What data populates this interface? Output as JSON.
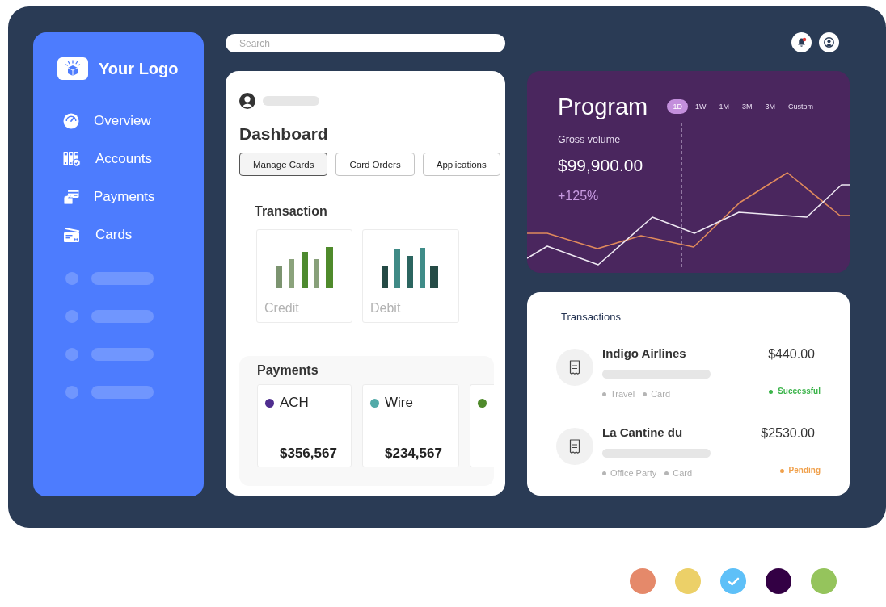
{
  "sidebar": {
    "logo_text": "Your Logo",
    "items": [
      {
        "label": "Overview"
      },
      {
        "label": "Accounts"
      },
      {
        "label": "Payments"
      },
      {
        "label": "Cards"
      }
    ]
  },
  "search": {
    "placeholder": "Search"
  },
  "dashboard": {
    "title": "Dashboard",
    "tabs": [
      {
        "label": "Manage Cards",
        "selected": true
      },
      {
        "label": "Card Orders",
        "selected": false
      },
      {
        "label": "Applications",
        "selected": false
      }
    ],
    "transaction": {
      "title": "Transaction",
      "tiles": [
        {
          "label": "Credit"
        },
        {
          "label": "Debit"
        }
      ]
    },
    "payments": {
      "title": "Payments",
      "tiles": [
        {
          "name": "ACH",
          "color": "#4f2d8f",
          "amount": "$356,567"
        },
        {
          "name": "Wire",
          "color": "#52aaa8",
          "amount": "$234,567"
        },
        {
          "color": "#4f8a2b"
        }
      ]
    }
  },
  "program": {
    "title": "Program",
    "ranges": [
      {
        "label": "1D",
        "selected": true
      },
      {
        "label": "1W",
        "selected": false
      },
      {
        "label": "1M",
        "selected": false
      },
      {
        "label": "3M",
        "selected": false
      },
      {
        "label": "3M",
        "selected": false
      },
      {
        "label": "Custom",
        "selected": false
      }
    ],
    "metric_label": "Gross volume",
    "value": "$99,900.00",
    "change": "+125%"
  },
  "transactions": {
    "title": "Transactions",
    "rows": [
      {
        "name": "Indigo Airlines",
        "amount": "$440.00",
        "tags": [
          "Travel",
          "Card"
        ],
        "status": {
          "label": "Successful",
          "color": "#3cb44b"
        }
      },
      {
        "name": "La Cantine du",
        "amount": "$2530.00",
        "tags": [
          "Office Party",
          "Card"
        ],
        "status": {
          "label": "Pending",
          "color": "#f0a04b"
        }
      }
    ]
  },
  "swatches": [
    {
      "color": "#e5896a",
      "selected": false
    },
    {
      "color": "#ecd068",
      "selected": false
    },
    {
      "color": "#5ec0f8",
      "selected": true
    },
    {
      "color": "#330044",
      "selected": false
    },
    {
      "color": "#95c45c",
      "selected": false
    }
  ]
}
